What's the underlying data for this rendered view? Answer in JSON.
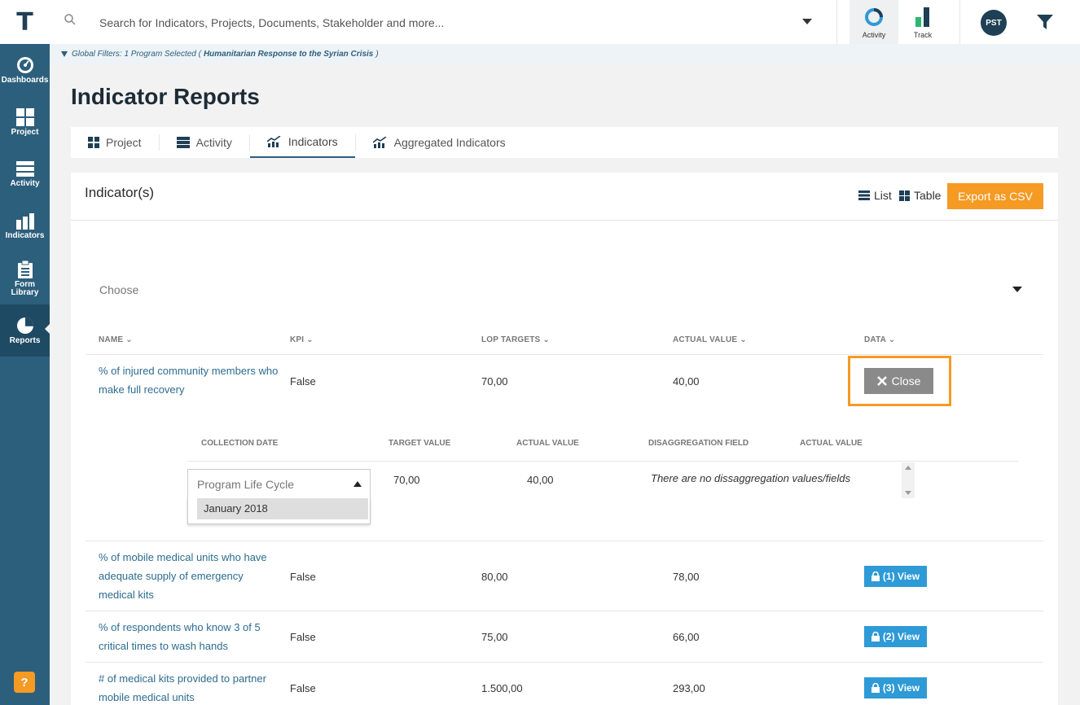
{
  "app": {
    "logo": "T"
  },
  "sidebar": {
    "items": [
      {
        "label": "Dashboards",
        "icon": "dashboard-icon"
      },
      {
        "label": "Project",
        "icon": "grid-icon"
      },
      {
        "label": "Activity",
        "icon": "server-icon"
      },
      {
        "label": "Indicators",
        "icon": "bar-chart-icon"
      },
      {
        "label_line1": "Form",
        "label_line2": "Library",
        "icon": "clipboard-icon"
      },
      {
        "label": "Reports",
        "icon": "pie-chart-icon",
        "active": true
      }
    ],
    "help": "?"
  },
  "topbar": {
    "search_placeholder": "Search for Indicators, Projects, Documents, Stakeholder and more...",
    "activity_label": "Activity",
    "track_label": "Track",
    "avatar": "PST"
  },
  "global_filter": {
    "prefix": "Global Filters: 1 Program Selected (",
    "program": "Humanitarian Response to the Syrian Crisis",
    "suffix": ")"
  },
  "page": {
    "title": "Indicator Reports"
  },
  "tabs": [
    {
      "label": "Project",
      "icon": "grid-icon"
    },
    {
      "label": "Activity",
      "icon": "server-icon"
    },
    {
      "label": "Indicators",
      "icon": "trend-chart-icon",
      "active": true
    },
    {
      "label": "Aggregated Indicators",
      "icon": "trend-chart-icon"
    }
  ],
  "panel": {
    "title": "Indicator(s)",
    "list_label": "List",
    "table_label": "Table",
    "export_label": "Export as CSV",
    "choose_placeholder": "Choose"
  },
  "table": {
    "headers": [
      "NAME",
      "KPI",
      "LOP TARGETS",
      "ACTUAL VALUE",
      "DATA"
    ],
    "rows": [
      {
        "name": "% of injured community members who make full recovery",
        "kpi": "False",
        "lop": "70,00",
        "actual": "40,00",
        "action": "Close"
      },
      {
        "name": "% of mobile medical units who have adequate supply of emergency medical kits",
        "kpi": "False",
        "lop": "80,00",
        "actual": "78,00",
        "action": "(1) View"
      },
      {
        "name": "% of respondents who know 3 of 5 critical times to wash hands",
        "kpi": "False",
        "lop": "75,00",
        "actual": "66,00",
        "action": "(2) View"
      },
      {
        "name": "# of medical kits provided to partner mobile medical units",
        "kpi": "False",
        "lop": "1.500,00",
        "actual": "293,00",
        "action": "(3) View"
      }
    ]
  },
  "detail": {
    "headers": [
      "COLLECTION DATE",
      "TARGET VALUE",
      "ACTUAL VALUE",
      "DISAGGREGATION FIELD",
      "ACTUAL VALUE"
    ],
    "select_value": "Program Life Cycle",
    "select_option": "January 2018",
    "target_value": "70,00",
    "actual_value": "40,00",
    "no_disagg": "There are no dissaggregation values/fields"
  },
  "colors": {
    "sidebar": "#2c5f7c",
    "accent": "#f59a23",
    "view_button": "#2e9ad6",
    "close_button": "#8a8a8a"
  }
}
